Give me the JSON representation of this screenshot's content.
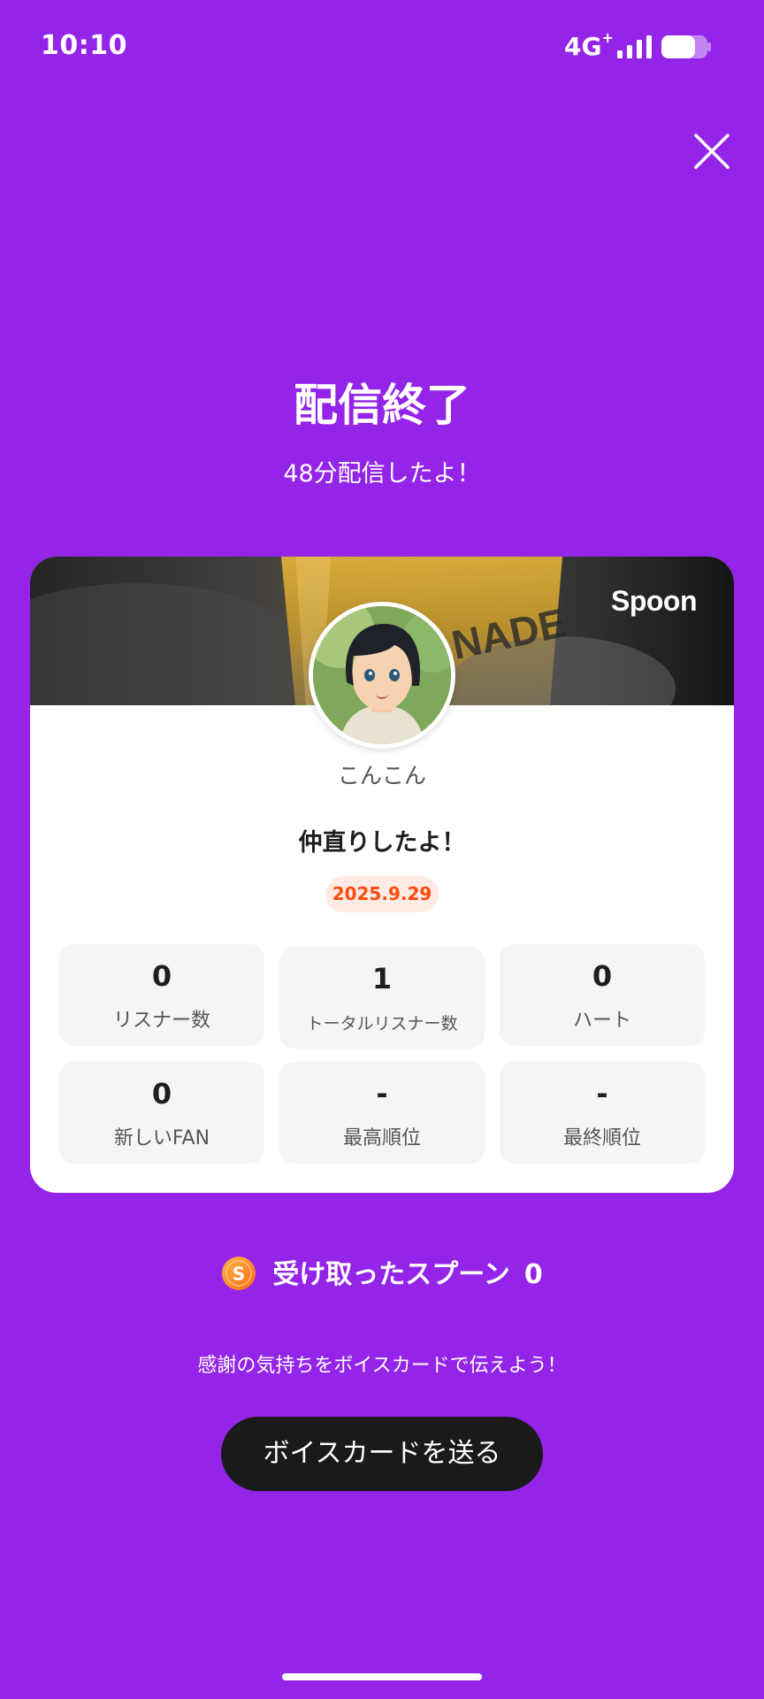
{
  "status_bar": {
    "time": "10:10",
    "network": "4G",
    "network_sup": "+"
  },
  "header": {
    "title": "配信終了",
    "subtitle": "48分配信したよ！"
  },
  "card": {
    "brand": "Spoon",
    "user_name": "こんこん",
    "live_title": "仲直りしたよ！",
    "date": "2025.9.29",
    "stats": [
      {
        "value": "0",
        "label": "リスナー数"
      },
      {
        "value": "1",
        "label": "トータルリスナー数"
      },
      {
        "value": "0",
        "label": "ハート"
      },
      {
        "value": "0",
        "label": "新しいFAN"
      },
      {
        "value": "-",
        "label": "最高順位"
      },
      {
        "value": "-",
        "label": "最終順位"
      }
    ]
  },
  "spoons": {
    "coin_letter": "S",
    "label": "受け取ったスプーン",
    "count": "0"
  },
  "voice_card": {
    "prompt": "感謝の気持ちをボイスカードで伝えよう！",
    "button_label": "ボイスカードを送る"
  },
  "colors": {
    "background": "#9324E8",
    "date_text": "#FF4A0D",
    "date_bg": "#FFEBE3",
    "button_bg": "#1A1A1A",
    "coin": "#FF8A1F"
  },
  "icons": {
    "close": "close-icon",
    "signal": "signal-bars-icon",
    "battery": "battery-icon",
    "coin": "spoon-coin-icon"
  }
}
